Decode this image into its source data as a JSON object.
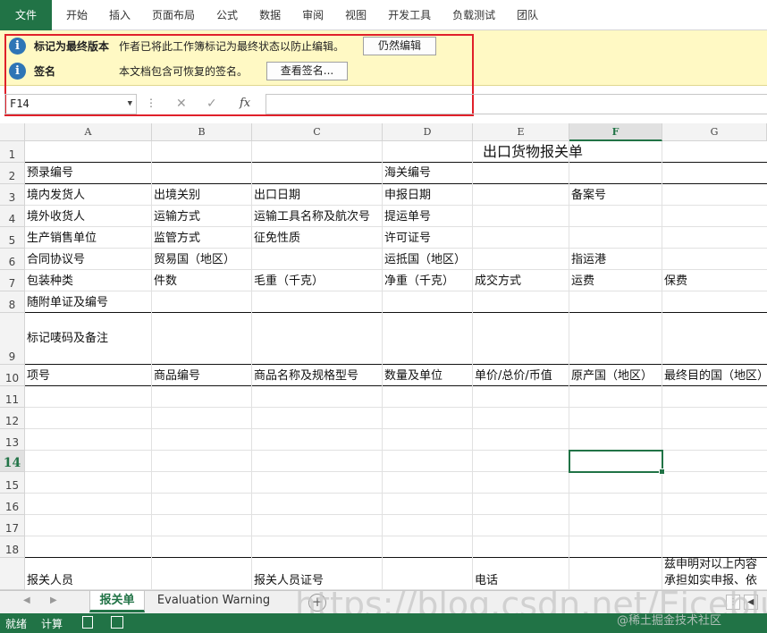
{
  "ribbon": {
    "tabs": [
      "文件",
      "开始",
      "插入",
      "页面布局",
      "公式",
      "数据",
      "审阅",
      "视图",
      "开发工具",
      "负载测试",
      "团队"
    ]
  },
  "message_bars": [
    {
      "title": "标记为最终版本",
      "text": "作者已将此工作簿标记为最终状态以防止编辑。",
      "button": "仍然编辑"
    },
    {
      "title": "签名",
      "text": "本文档包含可恢复的签名。",
      "button": "查看签名..."
    }
  ],
  "formula_bar": {
    "name_box": "F14",
    "formula": "",
    "fx_label": "fx"
  },
  "columns": [
    "A",
    "B",
    "C",
    "D",
    "E",
    "F",
    "G"
  ],
  "selected_column": "F",
  "selected_row": "14",
  "rows": [
    "1",
    "2",
    "3",
    "4",
    "5",
    "6",
    "7",
    "8",
    "9",
    "10",
    "11",
    "12",
    "13",
    "14",
    "15",
    "16",
    "17",
    "18",
    ""
  ],
  "cells": {
    "title": "出口货物报关单",
    "r2": {
      "a": "预录编号",
      "d": "海关编号"
    },
    "r3": {
      "a": "境内发货人",
      "b": "出境关别",
      "c": "出口日期",
      "d": "申报日期",
      "f": "备案号"
    },
    "r4": {
      "a": "境外收货人",
      "b": "运输方式",
      "c": "运输工具名称及航次号",
      "d": "提运单号"
    },
    "r5": {
      "a": "生产销售单位",
      "b": "监管方式",
      "c": "征免性质",
      "d": "许可证号"
    },
    "r6": {
      "a": "合同协议号",
      "b": "贸易国（地区）",
      "d": "运抵国（地区）",
      "f": "指运港"
    },
    "r7": {
      "a": "包装种类",
      "b": "件数",
      "c": "毛重（千克）",
      "d": "净重（千克）",
      "e": "成交方式",
      "f": "运费",
      "g": "保费"
    },
    "r8": {
      "a": "随附单证及编号"
    },
    "r9": {
      "a": "标记唛码及备注"
    },
    "r10": {
      "a": "项号",
      "b": "商品编号",
      "c": "商品名称及规格型号",
      "d": "数量及单位",
      "e": "单价/总价/币值",
      "f": "原产国（地区）",
      "g": "最终目的国（地区）"
    },
    "r19": {
      "a": "报关人员",
      "c": "报关人员证号",
      "e": "电话",
      "g1": "兹申明对以上内容",
      "g2": "承担如实申报、依"
    }
  },
  "sheet_tabs": [
    "报关单",
    "Evaluation Warning"
  ],
  "active_sheet": "报关单",
  "status_bar": {
    "ready": "就绪",
    "calculate": "计算"
  },
  "watermark": "https://blog.csdn.net/Eiceblue",
  "watermark_small": "@稀土掘金技术社区"
}
